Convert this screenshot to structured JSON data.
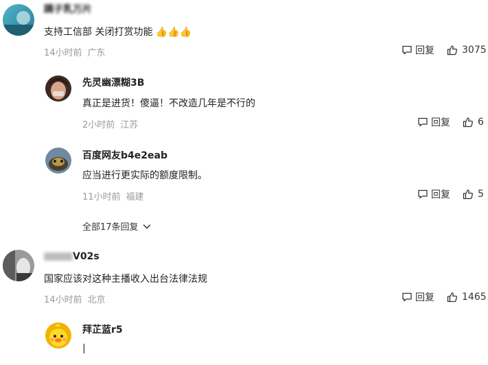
{
  "comments": [
    {
      "user": "蹒子乳万片",
      "text": "支持工信部 关闭打赏功能 👍👍👍",
      "time": "14小时前",
      "location": "广东",
      "reply_label": "回复",
      "likes": "3075",
      "replies": [
        {
          "user": "先灵幽漂糊3B",
          "text": "真正是进货！傻逼！不改造几年是不行的",
          "time": "2小时前",
          "location": "江苏",
          "reply_label": "回复",
          "likes": "6"
        },
        {
          "user": "百度网友b4e2eab",
          "text": "应当进行更实际的额度限制。",
          "time": "11小时前",
          "location": "福建",
          "reply_label": "回复",
          "likes": "5"
        }
      ],
      "expand_label": "全部17条回复"
    },
    {
      "user": "V02s",
      "text": "国家应该对这种主播收入出台法律法规",
      "time": "14小时前",
      "location": "北京",
      "reply_label": "回复",
      "likes": "1465",
      "replies": [
        {
          "user": "拜芷蓝r5",
          "text": "|",
          "time": "",
          "location": "",
          "reply_label": "",
          "likes": ""
        }
      ]
    }
  ],
  "colors": {
    "meta": "#9a9a9a",
    "text": "#222222"
  }
}
